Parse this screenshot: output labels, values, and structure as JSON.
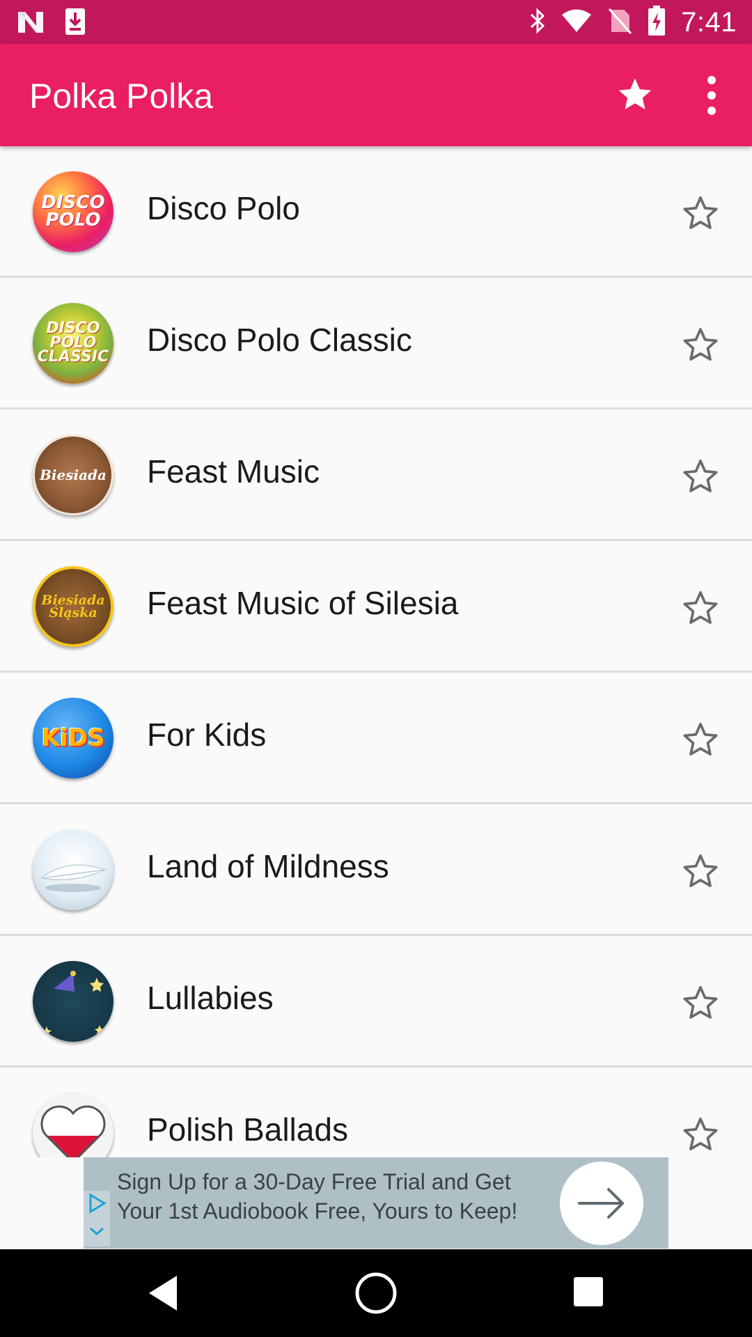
{
  "status_bar": {
    "time": "7:41",
    "left_icons": [
      "n-logo-icon",
      "download-icon"
    ],
    "right_icons": [
      "bluetooth-icon",
      "wifi-icon",
      "no-sim-icon",
      "battery-charging-icon"
    ]
  },
  "app_bar": {
    "title": "Polka Polka",
    "favorites_icon": "star-icon",
    "overflow_icon": "more-vert-icon",
    "background_color": "#e91e63"
  },
  "stations": [
    {
      "name": "Disco Polo",
      "logo": "disco-polo-logo",
      "logo_text": "DISCO\nPOLO",
      "favorite": false
    },
    {
      "name": "Disco Polo Classic",
      "logo": "disco-polo-classic-logo",
      "logo_text": "DISCO\nPOLO\nCLASSIC",
      "favorite": false
    },
    {
      "name": "Feast Music",
      "logo": "biesiada-logo",
      "logo_text": "Biesiada",
      "favorite": false
    },
    {
      "name": "Feast Music of Silesia",
      "logo": "biesiada-slaska-logo",
      "logo_text": "Biesiada\nŚląska",
      "favorite": false
    },
    {
      "name": "For Kids",
      "logo": "kids-logo",
      "logo_text": "KiDS",
      "favorite": false
    },
    {
      "name": "Land of Mildness",
      "logo": "feather-logo",
      "logo_text": "",
      "favorite": false
    },
    {
      "name": "Lullabies",
      "logo": "moon-logo",
      "logo_text": "",
      "favorite": false
    },
    {
      "name": "Polish Ballads",
      "logo": "heart-flag-logo",
      "logo_text": "",
      "favorite": false
    }
  ],
  "ad": {
    "text": "Sign Up for a 30-Day Free Trial and Get Your 1st Audiobook Free, Yours to Keep!",
    "cta_icon": "arrow-right-icon"
  },
  "nav_bar": {
    "icons": [
      "back-icon",
      "home-icon",
      "recents-icon"
    ]
  }
}
